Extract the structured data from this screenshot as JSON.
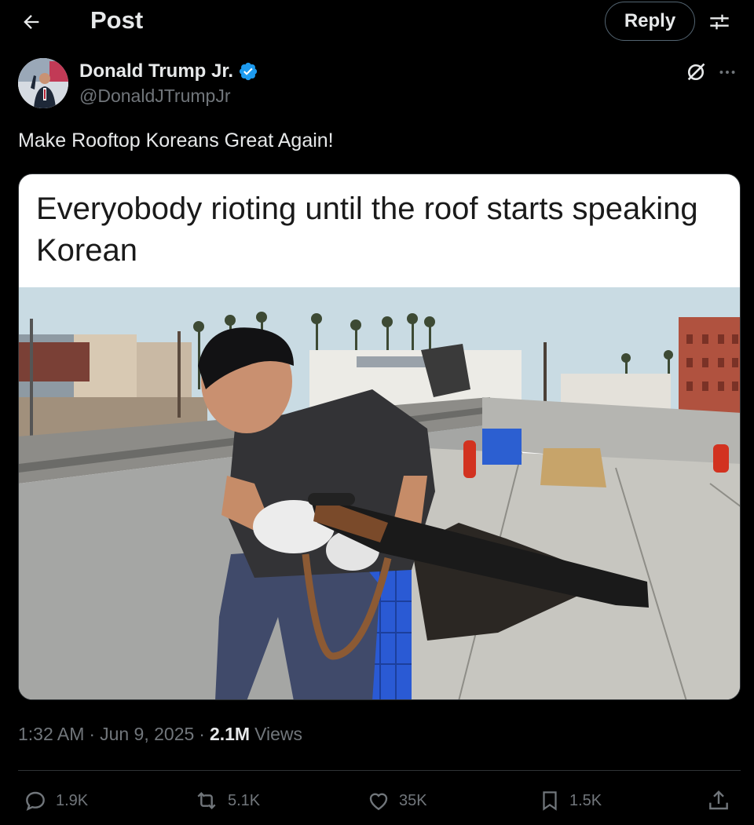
{
  "header": {
    "title": "Post",
    "reply_label": "Reply"
  },
  "author": {
    "name": "Donald Trump Jr.",
    "handle": "@DonaldJTrumpJr",
    "verified": true
  },
  "post": {
    "text": "Make Rooftop Koreans Great Again!",
    "meme_caption": "Everyobody rioting until the roof starts speaking Korean"
  },
  "meta": {
    "time": "1:32 AM",
    "separator": "·",
    "date": "Jun 9, 2025",
    "views_count": "2.1M",
    "views_label": "Views"
  },
  "actions": {
    "replies": "1.9K",
    "reposts": "5.1K",
    "likes": "35K",
    "bookmarks": "1.5K"
  },
  "colors": {
    "background": "#000000",
    "text": "#e7e9ea",
    "muted": "#71767b",
    "verified_blue": "#1d9bf0",
    "border": "#2f3336"
  }
}
